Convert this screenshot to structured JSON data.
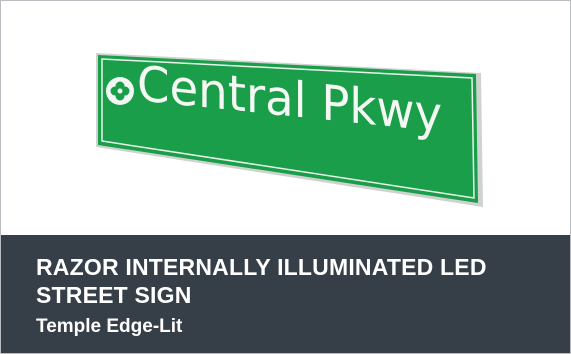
{
  "product": {
    "sign_text": "Central Pkwy",
    "sign_icon": "clover-emblem-icon",
    "title": "RAZOR INTERNALLY ILLUMINATED LED STREET SIGN",
    "subtitle": "Temple Edge-Lit"
  },
  "colors": {
    "sign_green": "#1a9e4a",
    "caption_background": "#363e47",
    "caption_text": "#ffffff"
  }
}
